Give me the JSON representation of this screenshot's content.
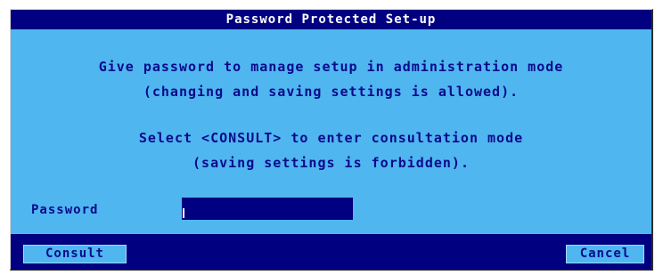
{
  "dialog": {
    "title": "Password Protected Set-up",
    "message_lines": [
      "Give password to manage setup in administration mode",
      "(changing and saving settings is allowed).",
      "Select <CONSULT> to enter consultation mode",
      "(saving settings is forbidden)."
    ],
    "password": {
      "label": "Password",
      "value": ""
    },
    "buttons": {
      "consult_label": "Consult",
      "cancel_label": "Cancel"
    }
  },
  "colors": {
    "dialog_background": "#4fb6ef",
    "bar_background": "#000080",
    "text": "#0a0a8c",
    "title_text": "#ffffff"
  }
}
